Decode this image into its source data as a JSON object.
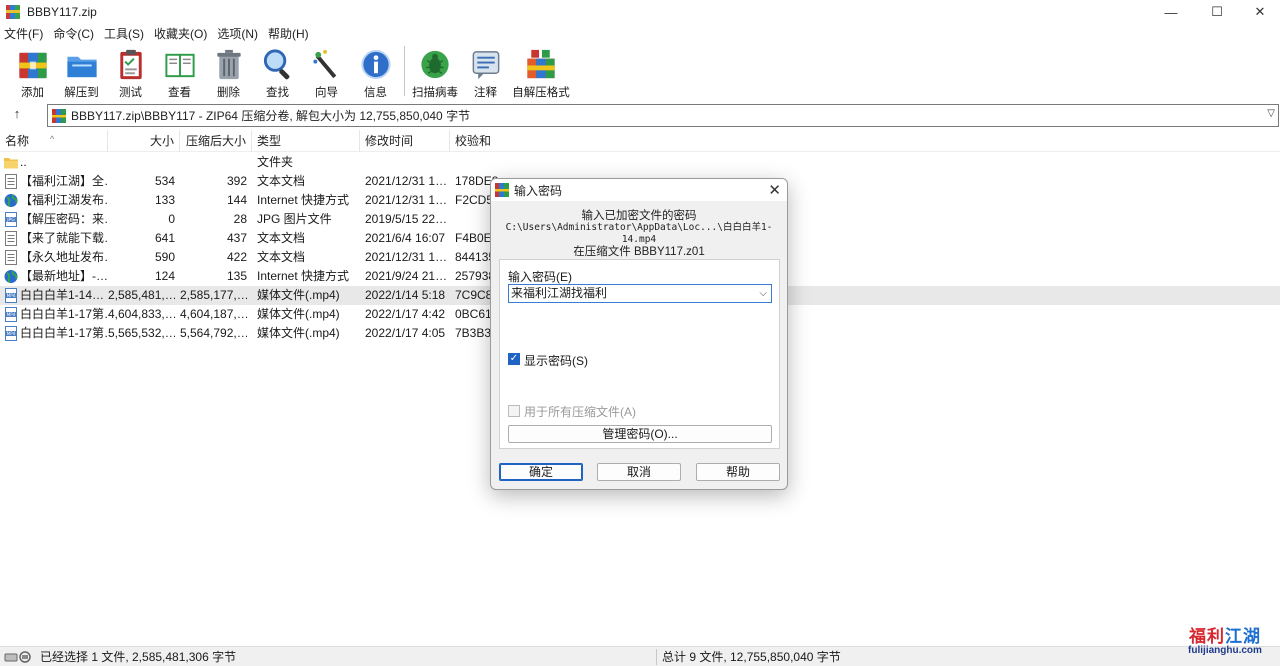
{
  "window": {
    "title": "BBBY117.zip",
    "minimize": "—",
    "maximize": "☐",
    "close": "✕"
  },
  "menu": [
    "文件(F)",
    "命令(C)",
    "工具(S)",
    "收藏夹(O)",
    "选项(N)",
    "帮助(H)"
  ],
  "toolbar": [
    {
      "label": "添加",
      "icon": "add-archive-icon"
    },
    {
      "label": "解压到",
      "icon": "extract-folder-icon"
    },
    {
      "label": "测试",
      "icon": "test-clipboard-icon"
    },
    {
      "label": "查看",
      "icon": "view-book-icon"
    },
    {
      "label": "删除",
      "icon": "trash-icon"
    },
    {
      "label": "查找",
      "icon": "magnifier-icon"
    },
    {
      "label": "向导",
      "icon": "wizard-wand-icon"
    },
    {
      "label": "信息",
      "icon": "info-icon"
    },
    {
      "label": "扫描病毒",
      "icon": "virus-scan-icon"
    },
    {
      "label": "注释",
      "icon": "comment-icon"
    },
    {
      "label": "自解压格式",
      "icon": "sfx-box-icon"
    }
  ],
  "address": {
    "up": "↑",
    "path": "BBBY117.zip\\BBBY117 - ZIP64 压缩分卷, 解包大小为 12,755,850,040 字节"
  },
  "columns": {
    "name": "名称",
    "size": "大小",
    "packed": "压缩后大小",
    "type": "类型",
    "modified": "修改时间",
    "crc": "校验和"
  },
  "files": [
    {
      "name": "..",
      "size": "",
      "packed": "",
      "type": "文件夹",
      "modified": "",
      "crc": "",
      "icon": "folder-icon"
    },
    {
      "name": "【福利江湖】全…",
      "size": "534",
      "packed": "392",
      "type": "文本文档",
      "modified": "2021/12/31 1…",
      "crc": "178DE8…",
      "icon": "text-file-icon"
    },
    {
      "name": "【福利江湖发布…",
      "size": "133",
      "packed": "144",
      "type": "Internet 快捷方式",
      "modified": "2021/12/31 1…",
      "crc": "F2CD5…",
      "icon": "globe-icon"
    },
    {
      "name": "【解压密码：来…",
      "size": "0",
      "packed": "28",
      "type": "JPG 图片文件",
      "modified": "2019/5/15 22…",
      "crc": "",
      "icon": "jpg-file-icon"
    },
    {
      "name": "【来了就能下载…",
      "size": "641",
      "packed": "437",
      "type": "文本文档",
      "modified": "2021/6/4 16:07",
      "crc": "F4B0E…",
      "icon": "text-file-icon"
    },
    {
      "name": "【永久地址发布…",
      "size": "590",
      "packed": "422",
      "type": "文本文档",
      "modified": "2021/12/31 1…",
      "crc": "844135…",
      "icon": "text-file-icon"
    },
    {
      "name": "【最新地址】-…",
      "size": "124",
      "packed": "135",
      "type": "Internet 快捷方式",
      "modified": "2021/9/24 21…",
      "crc": "257938…",
      "icon": "globe-icon"
    },
    {
      "name": "白白白羊1-14…",
      "size": "2,585,481,…",
      "packed": "2,585,177,…",
      "type": "媒体文件(.mp4)",
      "modified": "2022/1/14 5:18",
      "crc": "7C9C8…",
      "icon": "mp4-file-icon",
      "selected": true
    },
    {
      "name": "白白白羊1-17第…",
      "size": "4,604,833,…",
      "packed": "4,604,187,…",
      "type": "媒体文件(.mp4)",
      "modified": "2022/1/17 4:42",
      "crc": "0BC61…",
      "icon": "mp4-file-icon"
    },
    {
      "name": "白白白羊1-17第…",
      "size": "5,565,532,…",
      "packed": "5,564,792,…",
      "type": "媒体文件(.mp4)",
      "modified": "2022/1/17 4:05",
      "crc": "7B3B3…",
      "icon": "mp4-file-icon"
    }
  ],
  "status": {
    "left": "已经选择 1 文件, 2,585,481,306 字节",
    "right": "总计 9 文件, 12,755,850,040 字节"
  },
  "watermark": {
    "brand_red": "福利",
    "brand_blue": "江湖",
    "url": "fulijianghu.com"
  },
  "dialog": {
    "title": "输入密码",
    "close": "✕",
    "line1": "输入已加密文件的密码",
    "line2": "C:\\Users\\Administrator\\AppData\\Loc...\\白白白羊1-14.mp4",
    "line3": "在压缩文件 BBBY117.z01",
    "password_label": "输入密码(E)",
    "password_value": "来福利江湖找福利",
    "show_password": "显示密码(S)",
    "show_password_checked": true,
    "use_for_all": "用于所有压缩文件(A)",
    "use_for_all_checked": false,
    "manage": "管理密码(O)...",
    "ok": "确定",
    "cancel": "取消",
    "help": "帮助"
  }
}
